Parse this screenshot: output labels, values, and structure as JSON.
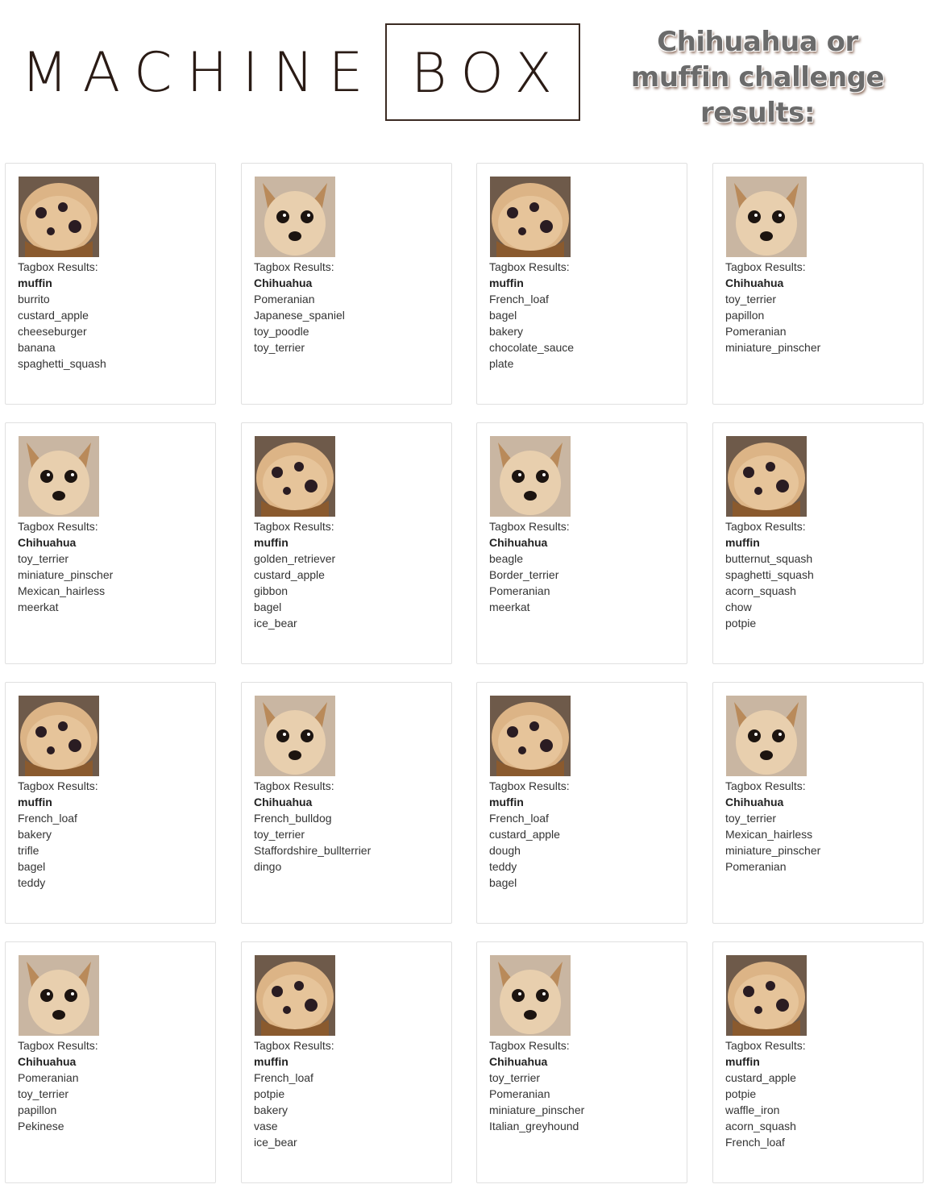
{
  "brand": {
    "logo_left": "MACHINE",
    "logo_right": "BOX",
    "headline_lines": [
      "Chihuahua or",
      "muffin challenge",
      "results:"
    ]
  },
  "colors": {
    "muffin_light": "#dcb486",
    "muffin_dark": "#8a5a2e",
    "blueberry": "#2a1c22",
    "dog_light": "#e8cfae",
    "dog_dark": "#b98a5a"
  },
  "result_label": "Tagbox Results:",
  "cards": [
    {
      "subject": "muffin-photo",
      "tags": [
        "muffin",
        "burrito",
        "custard_apple",
        "cheeseburger",
        "banana",
        "spaghetti_squash"
      ]
    },
    {
      "subject": "chihuahua-photo",
      "tags": [
        "Chihuahua",
        "Pomeranian",
        "Japanese_spaniel",
        "toy_poodle",
        "toy_terrier"
      ]
    },
    {
      "subject": "muffin-photo",
      "tags": [
        "muffin",
        "French_loaf",
        "bagel",
        "bakery",
        "chocolate_sauce",
        "plate"
      ]
    },
    {
      "subject": "chihuahua-photo",
      "tags": [
        "Chihuahua",
        "toy_terrier",
        "papillon",
        "Pomeranian",
        "miniature_pinscher"
      ]
    },
    {
      "subject": "chihuahua-photo",
      "tags": [
        "Chihuahua",
        "toy_terrier",
        "miniature_pinscher",
        "Mexican_hairless",
        "meerkat"
      ]
    },
    {
      "subject": "muffin-photo",
      "tags": [
        "muffin",
        "golden_retriever",
        "custard_apple",
        "gibbon",
        "bagel",
        "ice_bear"
      ]
    },
    {
      "subject": "chihuahua-photo",
      "tags": [
        "Chihuahua",
        "beagle",
        "Border_terrier",
        "Pomeranian",
        "meerkat"
      ]
    },
    {
      "subject": "muffin-photo",
      "tags": [
        "muffin",
        "butternut_squash",
        "spaghetti_squash",
        "acorn_squash",
        "chow",
        "potpie"
      ]
    },
    {
      "subject": "muffin-photo",
      "tags": [
        "muffin",
        "French_loaf",
        "bakery",
        "trifle",
        "bagel",
        "teddy"
      ]
    },
    {
      "subject": "chihuahua-photo",
      "tags": [
        "Chihuahua",
        "French_bulldog",
        "toy_terrier",
        "Staffordshire_bullterrier",
        "dingo"
      ]
    },
    {
      "subject": "muffin-photo",
      "tags": [
        "muffin",
        "French_loaf",
        "custard_apple",
        "dough",
        "teddy",
        "bagel"
      ]
    },
    {
      "subject": "chihuahua-photo",
      "tags": [
        "Chihuahua",
        "toy_terrier",
        "Mexican_hairless",
        "miniature_pinscher",
        "Pomeranian"
      ]
    },
    {
      "subject": "chihuahua-photo",
      "tags": [
        "Chihuahua",
        "Pomeranian",
        "toy_terrier",
        "papillon",
        "Pekinese"
      ]
    },
    {
      "subject": "muffin-photo",
      "tags": [
        "muffin",
        "French_loaf",
        "potpie",
        "bakery",
        "vase",
        "ice_bear"
      ]
    },
    {
      "subject": "chihuahua-photo",
      "tags": [
        "Chihuahua",
        "toy_terrier",
        "Pomeranian",
        "miniature_pinscher",
        "Italian_greyhound"
      ]
    },
    {
      "subject": "muffin-photo",
      "tags": [
        "muffin",
        "custard_apple",
        "potpie",
        "waffle_iron",
        "acorn_squash",
        "French_loaf"
      ]
    }
  ]
}
